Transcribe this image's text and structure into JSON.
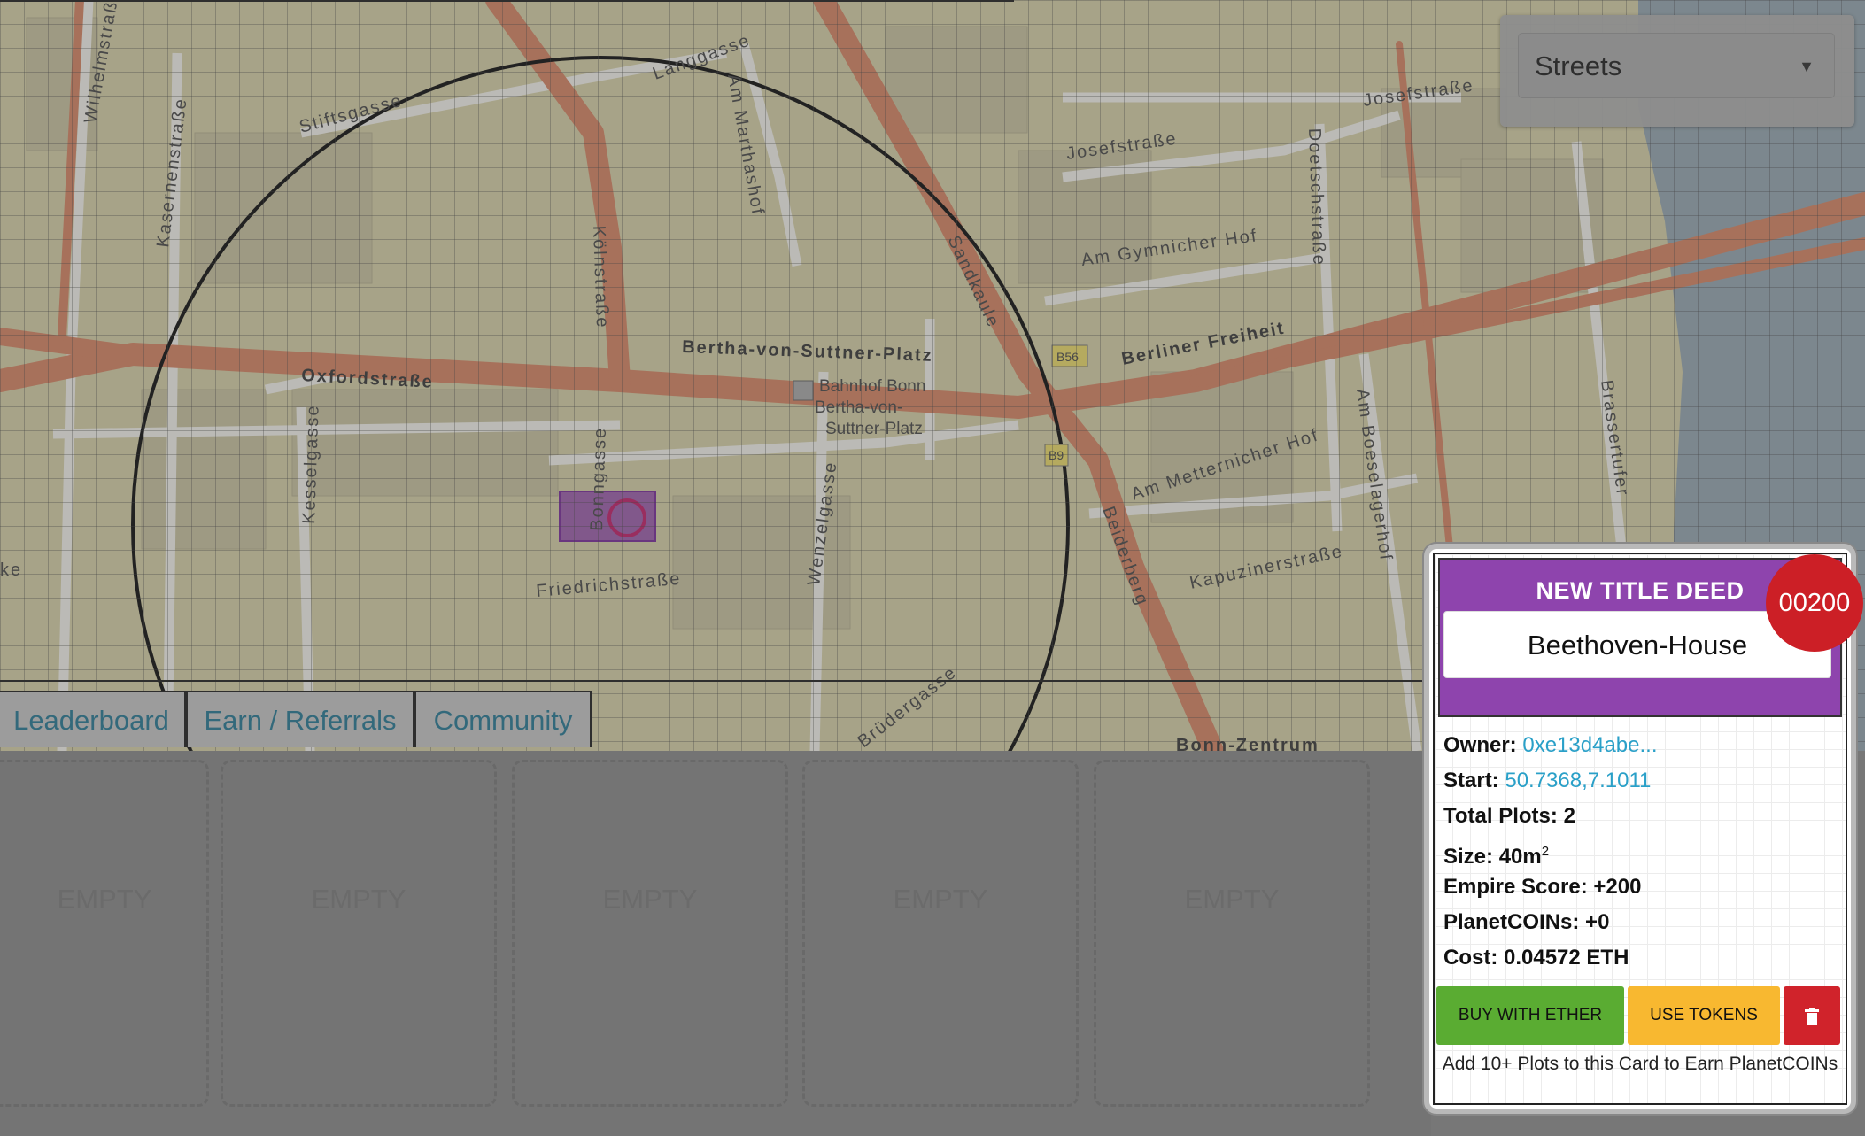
{
  "map": {
    "layer_select": {
      "value": "Streets"
    },
    "labels": {
      "wilhelmstrasse": "Wilhelmstraße",
      "stiftsgasse": "Stiftsgasse",
      "langgasse": "Langgasse",
      "am_marthashof": "Am Marthashof",
      "josefstrasse_top": "Josefstraße",
      "josefstrasse": "Josefstraße",
      "kasernenstrasse": "Kasernenstraße",
      "am_gymnicher_hof": "Am Gymnicher Hof",
      "doetschstrasse": "Doetschstraße",
      "koelnstrasse": "Kölnstraße",
      "sandkaule": "Sandkaule",
      "bertha_von_suttner_platz": "Bertha-von-Suttner-Platz",
      "b56": "B56",
      "berliner_freiheit": "Berliner Freiheit",
      "oxfordstrasse": "Oxfordstraße",
      "bahnhof_line1": "Bahnhof Bonn",
      "bahnhof_line2": "Bertha-von-",
      "bahnhof_line3": "Suttner-Platz",
      "kesselgasse": "Kesselgasse",
      "bonngasse": "Bonngasse",
      "b9": "B9",
      "am_metternicher_hof": "Am Metternicher Hof",
      "am_boeselagerhof": "Am Boeselagerhof",
      "brassertufer": "Brassertufer",
      "kapuzinerstrasse": "Kapuzinerstraße",
      "beiderberg": "Beiderberg",
      "friedrichstrasse": "Friedrichstraße",
      "wenzelgasse": "Wenzelgasse",
      "bruedergasse": "Brüdergasse",
      "bonn_zentrum": "Bonn-Zentrum",
      "ke": "ke"
    }
  },
  "tabs": [
    "Leaderboard",
    "Earn / Referrals",
    "Community"
  ],
  "slots": [
    "EMPTY",
    "EMPTY",
    "EMPTY",
    "EMPTY",
    "EMPTY"
  ],
  "deed": {
    "title": "NEW TITLE DEED",
    "name": "Beethoven-House",
    "badge": "00200",
    "owner_label": "Owner:",
    "owner_value": "0xe13d4abe...",
    "start_label": "Start:",
    "start_value": "50.7368,7.1011",
    "total_plots_label": "Total Plots:",
    "total_plots_value": "2",
    "size_label": "Size:",
    "size_value": "40m",
    "size_sup": "2",
    "empire_label": "Empire Score:",
    "empire_value": "+200",
    "planetcoins_label": "PlanetCOINs:",
    "planetcoins_value": "+0",
    "cost_label": "Cost:",
    "cost_value": "0.04572 ETH",
    "buy_label": "BUY WITH ETHER",
    "tokens_label": "USE TOKENS",
    "hint": "Add 10+ Plots to this Card to Earn PlanetCOINs"
  },
  "colors": {
    "deed_header": "#8e44ad",
    "badge": "#cc1f26",
    "buy_button": "#5aac32",
    "tokens_button": "#f8b830",
    "delete_button": "#d0232b",
    "link": "#2aa0c8",
    "tab_text": "#2a7a94"
  },
  "icons": {
    "delete": "trash-icon",
    "layer_caret": "caret-down-icon",
    "station": "train-station-icon"
  }
}
